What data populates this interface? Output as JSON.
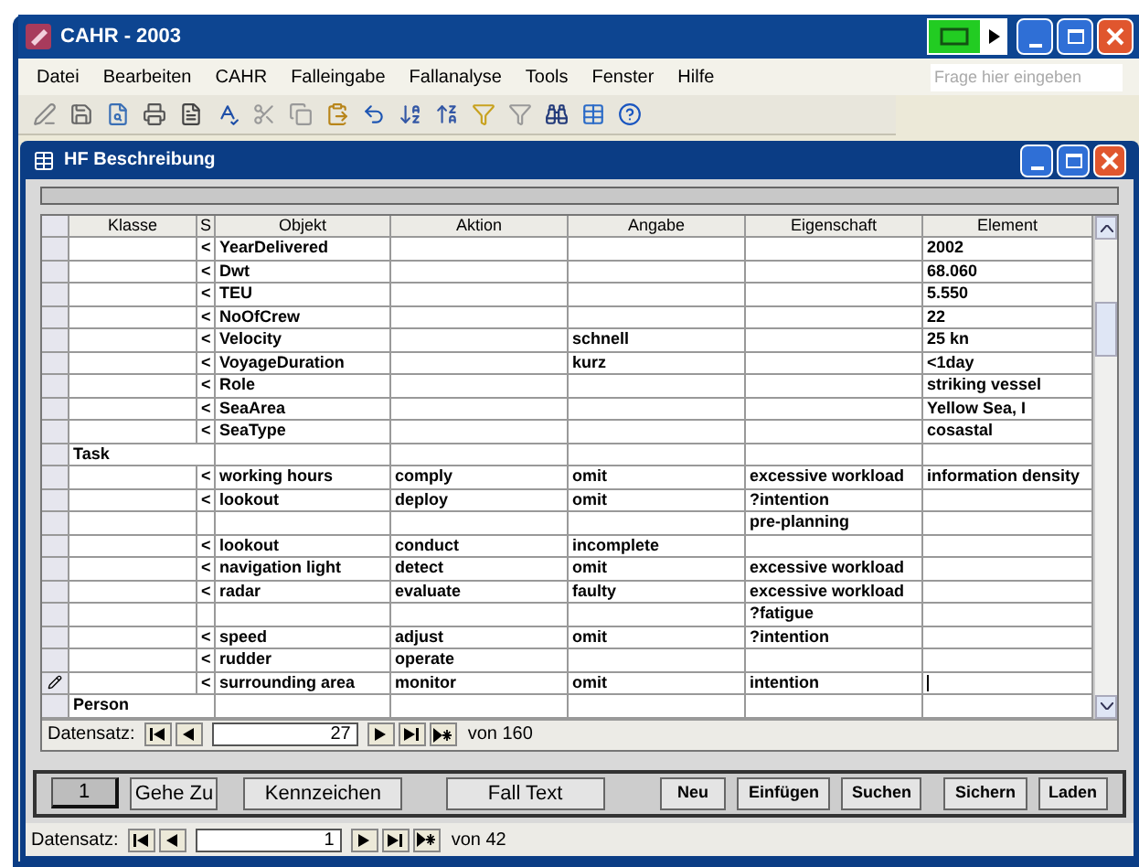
{
  "window": {
    "title": "CAHR - 2003"
  },
  "menu": [
    "Datei",
    "Bearbeiten",
    "CAHR",
    "Falleingabe",
    "Fallanalyse",
    "Tools",
    "Fenster",
    "Hilfe"
  ],
  "help_search": {
    "placeholder": "Frage hier eingeben"
  },
  "subwindow": {
    "title": "HF Beschreibung"
  },
  "table": {
    "columns": [
      "Klasse",
      "S",
      "Objekt",
      "Aktion",
      "Angabe",
      "Eigenschaft",
      "Element"
    ],
    "rows": [
      {
        "cells": [
          "",
          "<",
          "YearDelivered",
          "",
          "",
          "",
          "2002"
        ],
        "editing": false
      },
      {
        "cells": [
          "",
          "<",
          "Dwt",
          "",
          "",
          "",
          "68.060"
        ],
        "editing": false
      },
      {
        "cells": [
          "",
          "<",
          "TEU",
          "",
          "",
          "",
          "5.550"
        ],
        "editing": false
      },
      {
        "cells": [
          "",
          "<",
          "NoOfCrew",
          "",
          "",
          "",
          "22"
        ],
        "editing": false
      },
      {
        "cells": [
          "",
          "<",
          "Velocity",
          "",
          "schnell",
          "",
          "25 kn"
        ],
        "editing": false
      },
      {
        "cells": [
          "",
          "<",
          "VoyageDuration",
          "",
          "kurz",
          "",
          "<1day"
        ],
        "editing": false
      },
      {
        "cells": [
          "",
          "<",
          "Role",
          "",
          "",
          "",
          "striking vessel"
        ],
        "editing": false
      },
      {
        "cells": [
          "",
          "<",
          "SeaArea",
          "",
          "",
          "",
          "Yellow Sea, I"
        ],
        "editing": false
      },
      {
        "cells": [
          "",
          "<",
          "SeaType",
          "",
          "",
          "",
          "cosastal"
        ],
        "editing": false
      },
      {
        "cells": [
          "Task",
          "",
          "",
          "",
          "",
          "",
          ""
        ],
        "editing": false
      },
      {
        "cells": [
          "",
          "<",
          "working hours",
          "comply",
          "omit",
          "excessive workload",
          "information density"
        ],
        "editing": false
      },
      {
        "cells": [
          "",
          "<",
          "lookout",
          "deploy",
          "omit",
          "?intention",
          ""
        ],
        "editing": false
      },
      {
        "cells": [
          "",
          "",
          "",
          "",
          "",
          "pre-planning",
          ""
        ],
        "editing": false
      },
      {
        "cells": [
          "",
          "<",
          "lookout",
          "conduct",
          "incomplete",
          "",
          ""
        ],
        "editing": false
      },
      {
        "cells": [
          "",
          "<",
          "navigation light",
          "detect",
          "omit",
          "excessive workload",
          ""
        ],
        "editing": false
      },
      {
        "cells": [
          "",
          "<",
          "radar",
          "evaluate",
          "faulty",
          "excessive workload",
          ""
        ],
        "editing": false
      },
      {
        "cells": [
          "",
          "",
          "",
          "",
          "",
          "?fatigue",
          ""
        ],
        "editing": false
      },
      {
        "cells": [
          "",
          "<",
          "speed",
          "adjust",
          "omit",
          "?intention",
          ""
        ],
        "editing": false
      },
      {
        "cells": [
          "",
          "<",
          "rudder",
          "operate",
          "",
          "",
          ""
        ],
        "editing": false
      },
      {
        "cells": [
          "",
          "<",
          "surrounding area",
          "monitor",
          "omit",
          "intention",
          ""
        ],
        "editing": true
      },
      {
        "cells": [
          "Person",
          "",
          "",
          "",
          "",
          "",
          ""
        ],
        "editing": false
      }
    ]
  },
  "inner_nav": {
    "label": "Datensatz:",
    "record": "27",
    "total": "von 160"
  },
  "buttons": [
    {
      "label": "1",
      "kind": "field"
    },
    {
      "label": "Gehe Zu",
      "kind": "button"
    },
    {
      "label": "Kennzeichen",
      "kind": "button"
    },
    {
      "label": "Fall Text",
      "kind": "button"
    },
    {
      "label": "Neu",
      "kind": "small"
    },
    {
      "label": "Einfügen",
      "kind": "small"
    },
    {
      "label": "Suchen",
      "kind": "small"
    },
    {
      "label": "Sichern",
      "kind": "small"
    },
    {
      "label": "Laden",
      "kind": "small"
    }
  ],
  "outer_nav": {
    "label": "Datensatz:",
    "record": "1",
    "total": "von 42"
  }
}
